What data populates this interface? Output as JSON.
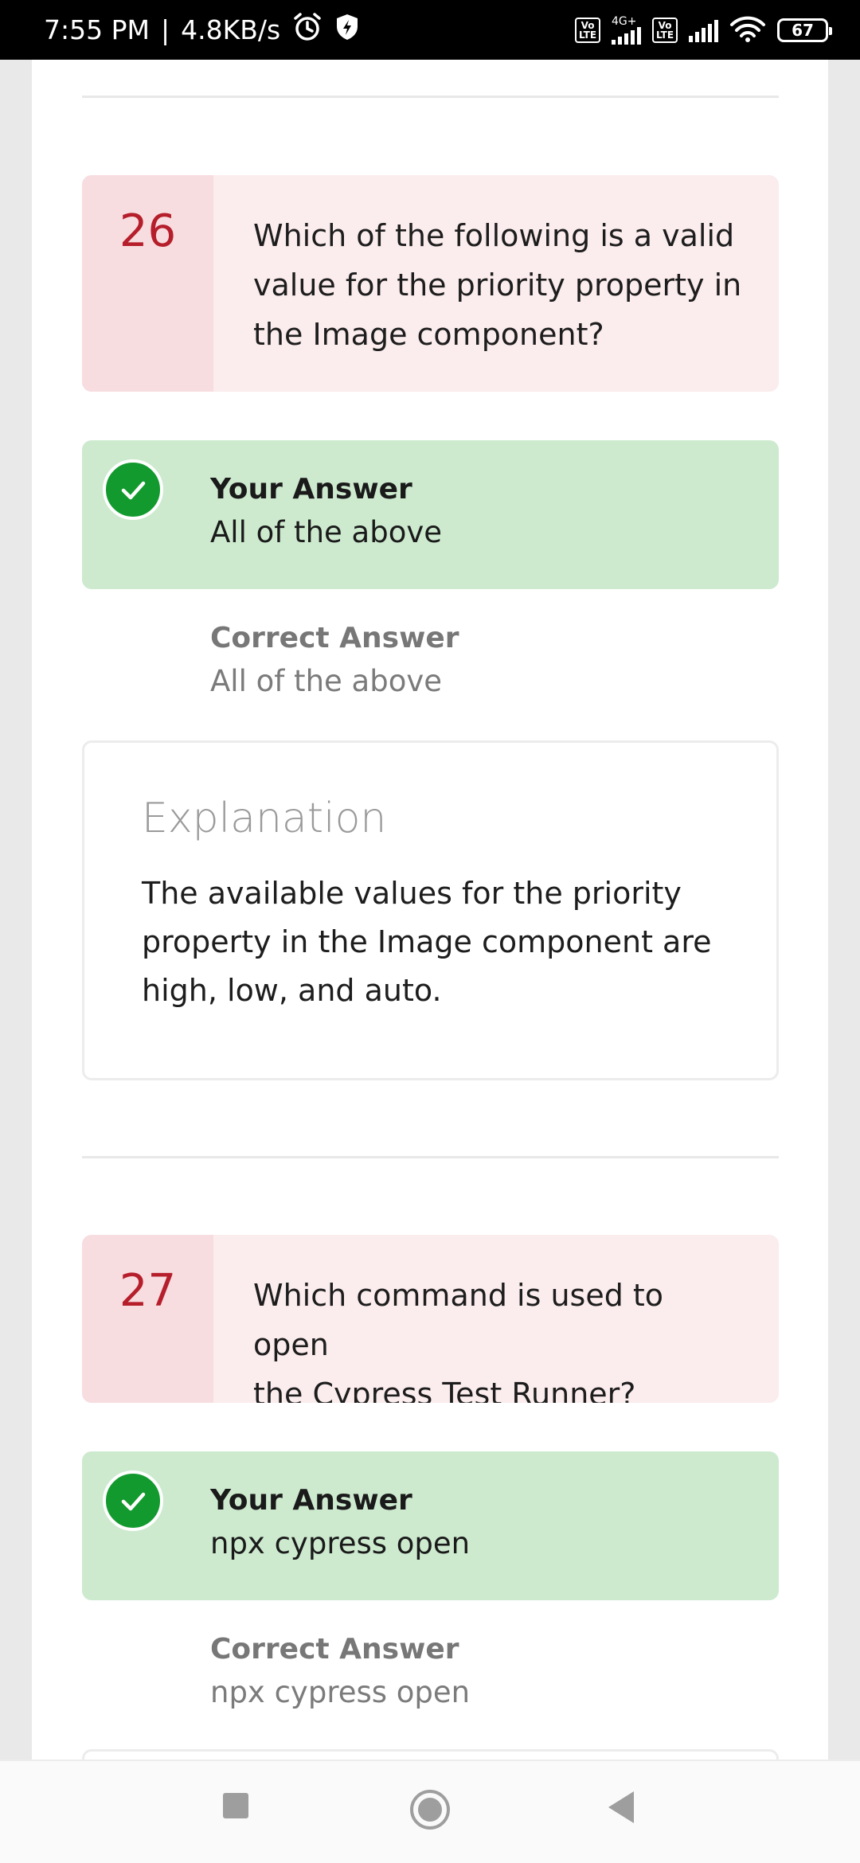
{
  "status_bar": {
    "time": "7:55 PM",
    "separator": "|",
    "speed": "4.8KB/s",
    "network_type": "4G+",
    "volte_label_1": "Vo LTE",
    "volte_label_2": "Vo LTE",
    "battery": "67"
  },
  "questions": [
    {
      "number": "26",
      "line1": "Which of the following is a valid",
      "line2": "value for the priority property in",
      "line3": "the Image component?",
      "your_answer_label": "Your Answer",
      "your_answer": "All of the above",
      "correct_answer_label": "Correct Answer",
      "correct_answer": "All of the above",
      "explanation_title": "Explanation",
      "explanation_line1": "The available values for the priority",
      "explanation_line2": "property in the Image component are",
      "explanation_line3": "high, low, and auto."
    },
    {
      "number": "27",
      "line1": "Which command is used to open",
      "line2": "the Cypress Test Runner?",
      "your_answer_label": "Your Answer",
      "your_answer": "npx cypress open",
      "correct_answer_label": "Correct Answer",
      "correct_answer": "npx cypress open"
    }
  ],
  "colors": {
    "question_number": "#b51e2a",
    "your_answer_bg": "#cdeacf",
    "check": "#139a2e"
  }
}
